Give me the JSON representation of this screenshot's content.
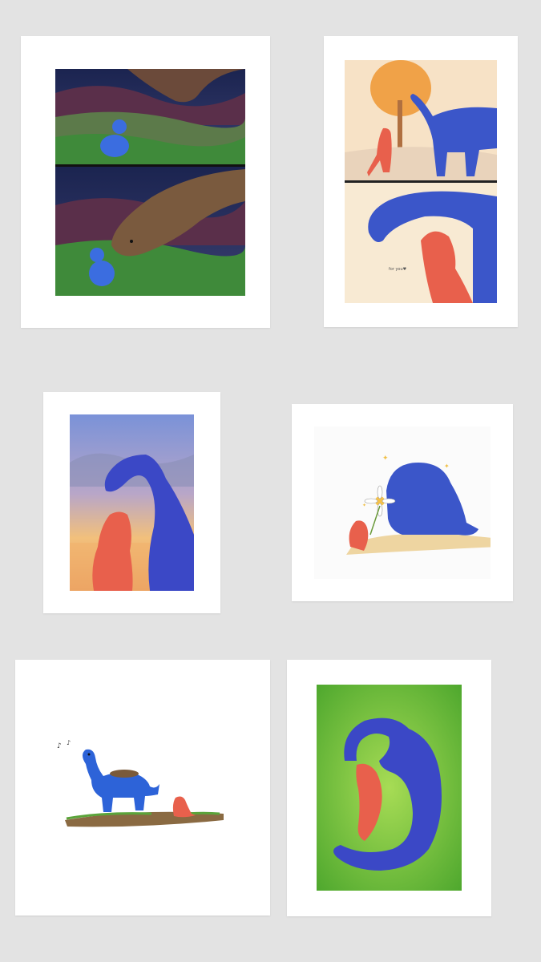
{
  "gallery": {
    "background": "#e3e3e3",
    "prints": [
      {
        "name": "print-night-meeting",
        "subject": "blue baby dinosaur meeting brown long-neck at night (two panels)"
      },
      {
        "name": "print-orange-tree",
        "subject": "red dinosaur and blue long-neck under orange tree (two panels)",
        "caption": "for you♥"
      },
      {
        "name": "print-sunset-hug",
        "subject": "blue long-neck nuzzling red dinosaur at sunset"
      },
      {
        "name": "print-flower-gift",
        "subject": "red dinosaur offering a daisy to resting blue dinosaur"
      },
      {
        "name": "print-nest-walk",
        "subject": "blue dinosaur carrying nest, small red dinosaur following"
      },
      {
        "name": "print-curled-sleep",
        "subject": "blue long-neck curled around red dinosaur on grass"
      }
    ]
  },
  "colors": {
    "blue_dino": "#3b56c9",
    "red_dino": "#e8604c",
    "grass": "#6cc43a"
  }
}
